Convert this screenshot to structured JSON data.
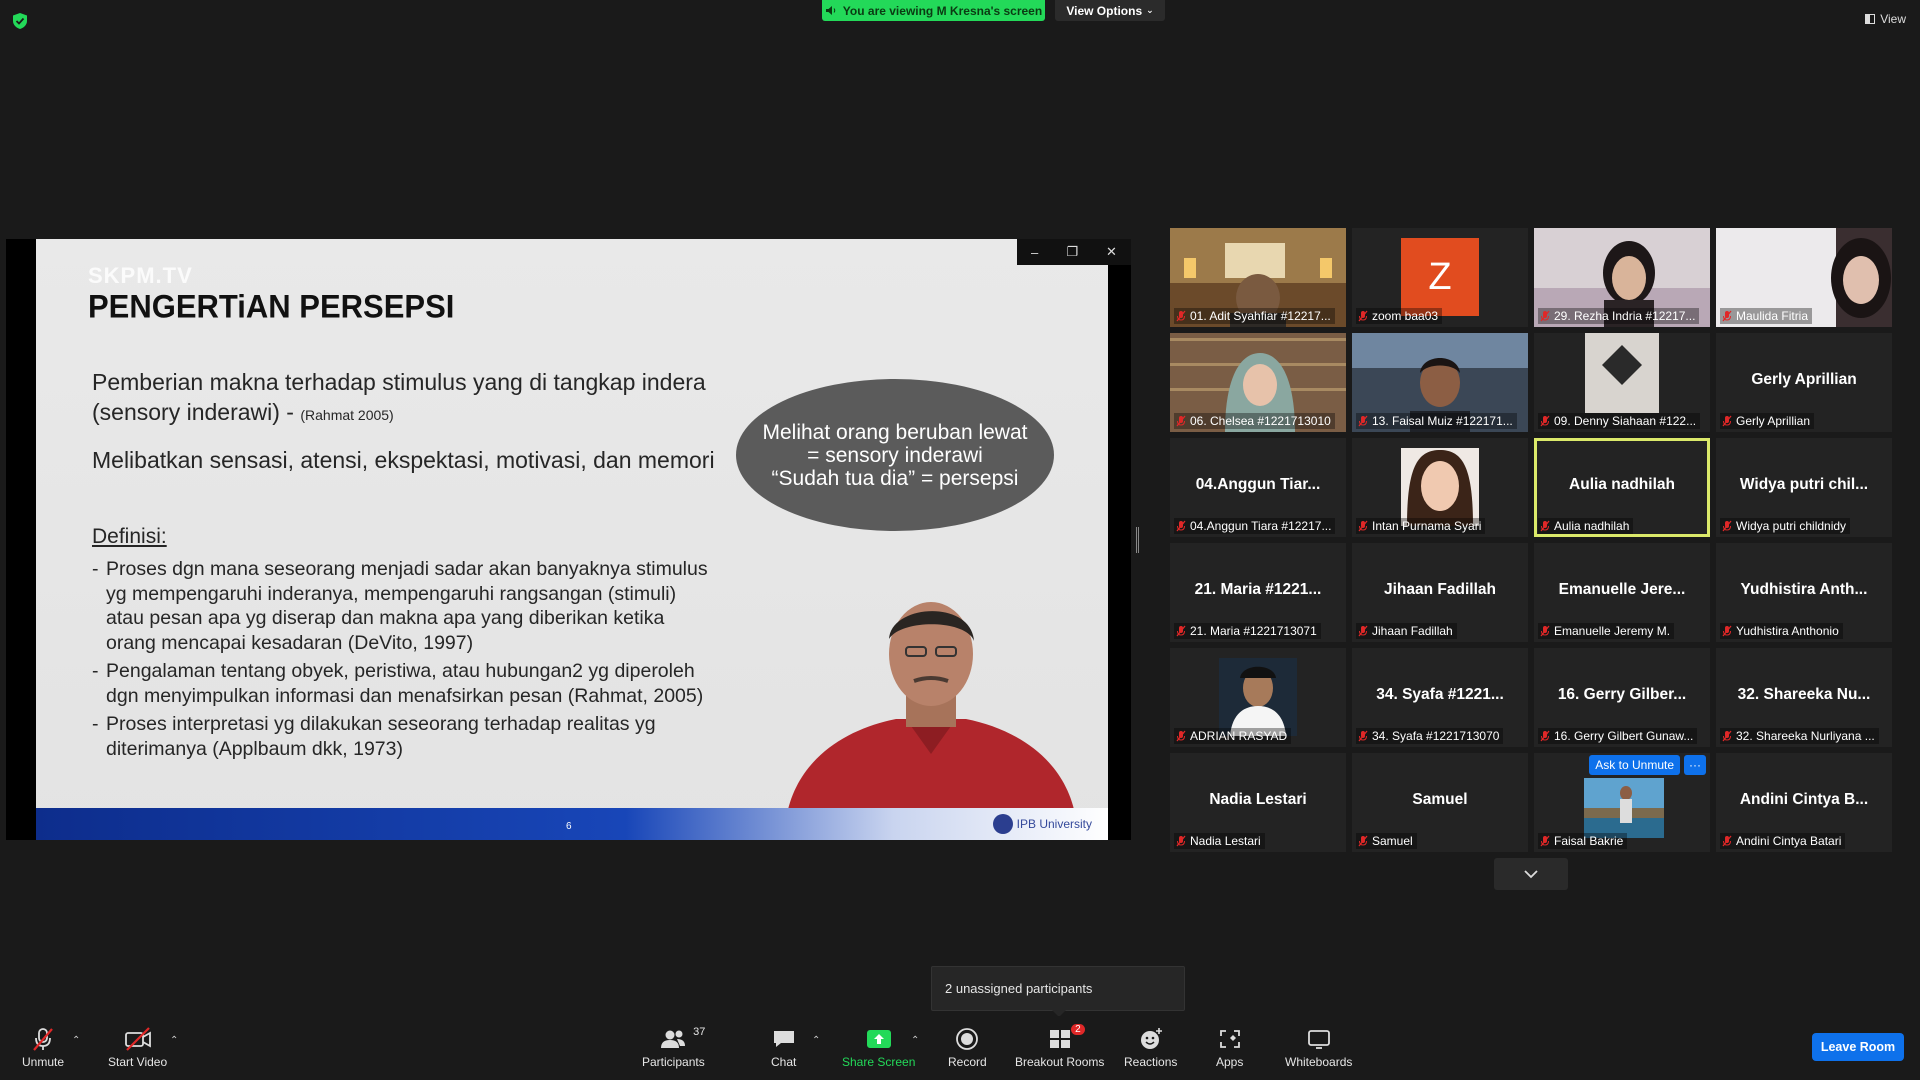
{
  "top": {
    "viewing_banner": "You are viewing M Kresna's screen",
    "view_options": "View Options",
    "view_label": "View"
  },
  "slide": {
    "watermark": "SKPM.TV",
    "title": "PENGERTiAN PERSEPSI",
    "line1": "Pemberian makna terhadap stimulus yang di tangkap indera (sensory inderawi) -",
    "line1_cite": "(Rahmat 2005)",
    "line2": "Melibatkan sensasi, atensi, ekspektasi, motivasi, dan memori",
    "definisi": "Definisi:",
    "bullets": [
      "Proses dgn mana seseorang menjadi sadar akan banyaknya stimulus yg mempengaruhi inderanya, mempengaruhi rangsangan (stimuli) atau pesan apa yg diserap dan makna apa yang diberikan ketika orang mencapai kesadaran (DeVito, 1997)",
      "Pengalaman tentang obyek, peristiwa, atau hubungan2 yg diperoleh dgn menyimpulkan informasi dan menafsirkan pesan (Rahmat, 2005)",
      "Proses interpretasi yg dilakukan seseorang terhadap realitas yg diterimanya (Applbaum dkk, 1973)"
    ],
    "oval_text": "Melihat orang beruban lewat\n= sensory inderawi\n“Sudah tua dia” = persepsi",
    "page_number": "6",
    "logo_text": "IPB University"
  },
  "participants": [
    {
      "label": "01. Adit Syahfiar #12217...",
      "big": "",
      "kind": "photo-room"
    },
    {
      "label": "zoom baa03",
      "big": "",
      "kind": "avatar-z",
      "avatar_letter": "Z"
    },
    {
      "label": "29. Rezha Indria #12217...",
      "big": "",
      "kind": "photo-girl"
    },
    {
      "label": "Maulida Fitria",
      "big": "",
      "kind": "photo-girl2"
    },
    {
      "label": "06. Chelsea #1221713010",
      "big": "",
      "kind": "photo-hijab"
    },
    {
      "label": "13. Faisal Muiz #122171...",
      "big": "",
      "kind": "photo-boy"
    },
    {
      "label": "09. Denny Siahaan #122...",
      "big": "",
      "kind": "photo-diamond"
    },
    {
      "label": "Gerly Aprillian",
      "big": "Gerly Aprillian",
      "kind": "name"
    },
    {
      "label": "04.Anggun Tiara #12217...",
      "big": "04.Anggun Tiar...",
      "kind": "name"
    },
    {
      "label": "Intan Purnama Syari",
      "big": "",
      "kind": "photo-woman"
    },
    {
      "label": "Aulia nadhilah",
      "big": "Aulia nadhilah",
      "kind": "name",
      "active": true
    },
    {
      "label": "Widya putri childnidy",
      "big": "Widya putri chil...",
      "kind": "name"
    },
    {
      "label": "21. Maria #1221713071",
      "big": "21. Maria #1221...",
      "kind": "name"
    },
    {
      "label": "Jihaan Fadillah",
      "big": "Jihaan Fadillah",
      "kind": "name"
    },
    {
      "label": "Emanuelle Jeremy M.",
      "big": "Emanuelle Jere...",
      "kind": "name"
    },
    {
      "label": "Yudhistira Anthonio",
      "big": "Yudhistira Anth...",
      "kind": "name"
    },
    {
      "label": "ADRIAN RASYAD",
      "big": "",
      "kind": "photo-suit"
    },
    {
      "label": "34. Syafa #1221713070",
      "big": "34. Syafa #1221...",
      "kind": "name"
    },
    {
      "label": "16. Gerry Gilbert Gunaw...",
      "big": "16. Gerry Gilber...",
      "kind": "name"
    },
    {
      "label": "32. Shareeka Nurliyana ...",
      "big": "32. Shareeka Nu...",
      "kind": "name"
    },
    {
      "label": "Nadia Lestari",
      "big": "Nadia Lestari",
      "kind": "name"
    },
    {
      "label": "Samuel",
      "big": "Samuel",
      "kind": "name"
    },
    {
      "label": "Faisal Bakrie",
      "big": "",
      "kind": "photo-beach",
      "hover": true
    },
    {
      "label": "Andini Cintya Batari",
      "big": "Andini Cintya B...",
      "kind": "name"
    }
  ],
  "hover_actions": {
    "ask_unmute": "Ask to Unmute",
    "more": "···"
  },
  "toast": "2 unassigned participants",
  "toolbar": {
    "unmute": "Unmute",
    "start_video": "Start Video",
    "participants": "Participants",
    "participants_count": "37",
    "chat": "Chat",
    "share_screen": "Share Screen",
    "record": "Record",
    "breakout_rooms": "Breakout Rooms",
    "breakout_badge": "2",
    "reactions": "Reactions",
    "apps": "Apps",
    "whiteboards": "Whiteboards",
    "leave": "Leave Room"
  },
  "colors": {
    "accent": "#0e71eb",
    "share_green": "#23d959",
    "active_border": "#dbe96a",
    "mute_red": "#e02828"
  }
}
